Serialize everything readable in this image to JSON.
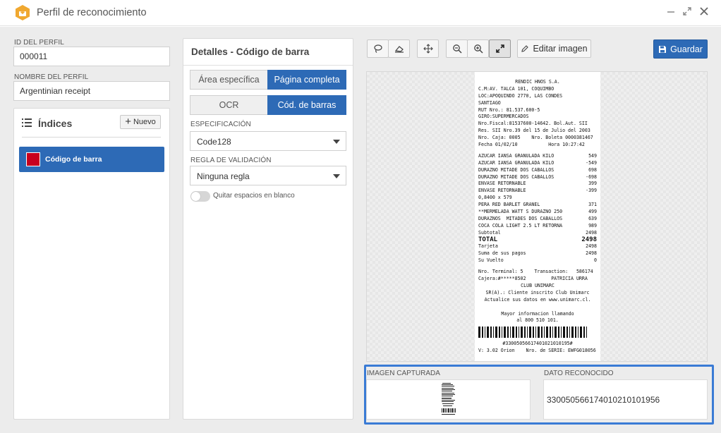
{
  "window": {
    "title": "Perfil de reconocimiento"
  },
  "profile": {
    "id_label": "ID DEL PERFIL",
    "id_value": "000011",
    "name_label": "NOMBRE DEL PERFIL",
    "name_value": "Argentinian receipt"
  },
  "indices": {
    "title": "Índices",
    "new_button": "Nuevo",
    "items": [
      {
        "label": "Código de barra",
        "color": "#c8001e"
      }
    ]
  },
  "details": {
    "title": "Detalles - Código de barra",
    "area_tabs": {
      "specific": "Área específica",
      "full": "Página completa",
      "selected": "full"
    },
    "mode_tabs": {
      "ocr": "OCR",
      "barcode": "Cód. de barras",
      "selected": "barcode"
    },
    "spec_label": "ESPECIFICACIÓN",
    "spec_value": "Code128",
    "rule_label": "REGLA DE VALIDACIÓN",
    "rule_value": "Ninguna regla",
    "toggle_label": "Quitar espacios en blanco",
    "toggle_on": false
  },
  "toolbar": {
    "edit_image": "Editar imagen",
    "save": "Guardar",
    "icons": [
      "lasso-icon",
      "eraser-icon",
      "move-icon",
      "zoom-out-icon",
      "zoom-in-icon",
      "expand-icon"
    ],
    "active_icon": "expand-icon"
  },
  "receipt": {
    "header_lines": [
      "RENDIC HNOS S.A.",
      "C.M:AV. TALCA 101, COQUIMBO",
      "LOC:APOQUINDO 2770, LAS CONDES",
      "SANTIAGO",
      "RUT Nro.: 81.537.600-5",
      "GIRO:SUPERMERCADOS",
      "Nro.Fiscal:81537600-14642. Bol.Aut. SII",
      "Res. SII Nro.39 del 15 de Julio del 2003",
      "Nro. Caja: 0005    Nro. Boleta 0000381467",
      "Fecha 01/02/10           Hora 10:27:42"
    ],
    "items": [
      {
        "desc": "AZUCAR IANSA GRANULADA KILO",
        "amount": "549"
      },
      {
        "desc": "AZUCAR IANSA GRANULADA KILO",
        "amount": "-549"
      },
      {
        "desc": "DURAZNO MITADE DOS CABALLOS",
        "amount": "698"
      },
      {
        "desc": "DURAZNO MITADE DOS CABALLOS",
        "amount": "-698"
      },
      {
        "desc": "ENVASE RETORNABLE",
        "amount": "399"
      },
      {
        "desc": "ENVASE RETORNABLE",
        "amount": "-399"
      },
      {
        "desc": "0,8400 x 579",
        "amount": ""
      },
      {
        "desc": "PERA RED BARLET GRANEL",
        "amount": "371"
      },
      {
        "desc": "**MERMELADA WATT S DURAZNO 250",
        "amount": "499"
      },
      {
        "desc": "DURAZNOS  MITADES DOS CABALLOS",
        "amount": "639"
      },
      {
        "desc": "COCA COLA LIGHT 2.5 LT RETORNA",
        "amount": "989"
      },
      {
        "desc": "Subtotal",
        "amount": "2498"
      }
    ],
    "total_label": "TOTAL",
    "total_value": "2498",
    "payments": [
      {
        "desc": "Tarjeta",
        "amount": "2498"
      },
      {
        "desc": "Suma de sus pagos",
        "amount": "2498"
      },
      {
        "desc": "Su Vuelto",
        "amount": "0"
      }
    ],
    "footer_lines": [
      "Nro. Terminal: 5    Transaction:   586174",
      "Cajera:#*****8502         PATRICIA URRA",
      "CLUB UNIMARC",
      "SR(A).: Cliente inscrito Club Unimarc",
      "Actualice sus datos en www.unimarc.cl.",
      "",
      "Mayor informacion llamando",
      "al 800 510 101."
    ],
    "barcode_text": "#33005056617401021010195#",
    "version_line": "V: 3.02 Orion    Nro. de SERIE: EWFG018056"
  },
  "capture": {
    "image_label": "IMAGEN CAPTURADA",
    "data_label": "DATO RECONOCIDO",
    "data_value": "33005056617401021010195​6"
  }
}
